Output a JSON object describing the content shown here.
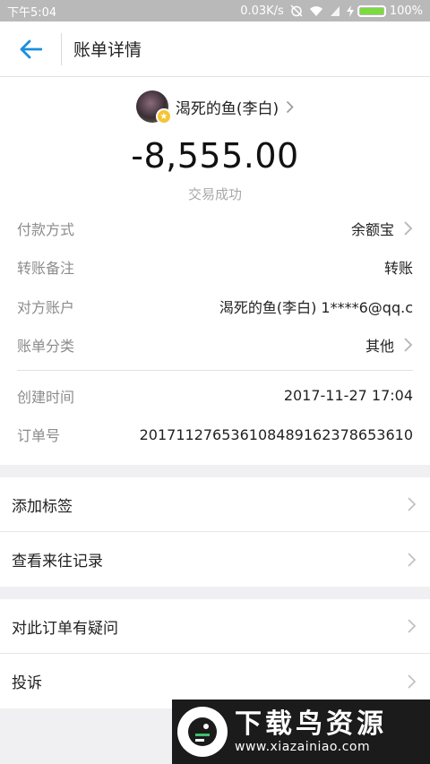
{
  "status_bar": {
    "time": "下午5:04",
    "network_speed": "0.03K/s",
    "battery_percent": "100%",
    "battery_level": 1.0
  },
  "header": {
    "title": "账单详情",
    "back_icon": "arrow-left-icon"
  },
  "payee": {
    "name": "渴死的鱼(李白)"
  },
  "amount": "-8,555.00",
  "status": "交易成功",
  "details": [
    {
      "label": "付款方式",
      "value": "余额宝",
      "chevron": true
    },
    {
      "label": "转账备注",
      "value": "转账",
      "chevron": false
    },
    {
      "label": "对方账户",
      "value": "渴死的鱼(李白) 1****6@qq.c",
      "chevron": false
    },
    {
      "label": "账单分类",
      "value": "其他",
      "chevron": true
    }
  ],
  "details2": [
    {
      "label": "创建时间",
      "value": "2017-11-27 17:04"
    },
    {
      "label": "订单号",
      "value": "20171127653610848916237865361​0"
    }
  ],
  "actions_1": [
    {
      "label": "添加标签"
    },
    {
      "label": "查看来往记录"
    }
  ],
  "actions_2": [
    {
      "label": "对此订单有疑问"
    },
    {
      "label": "投诉"
    }
  ],
  "watermark": {
    "title": "下载鸟资源",
    "url": "www.xiazainiao.com"
  },
  "colors": {
    "accent": "#1a8fdc",
    "status_bar": "#b9b9b9",
    "muted": "#8c8c8c"
  }
}
